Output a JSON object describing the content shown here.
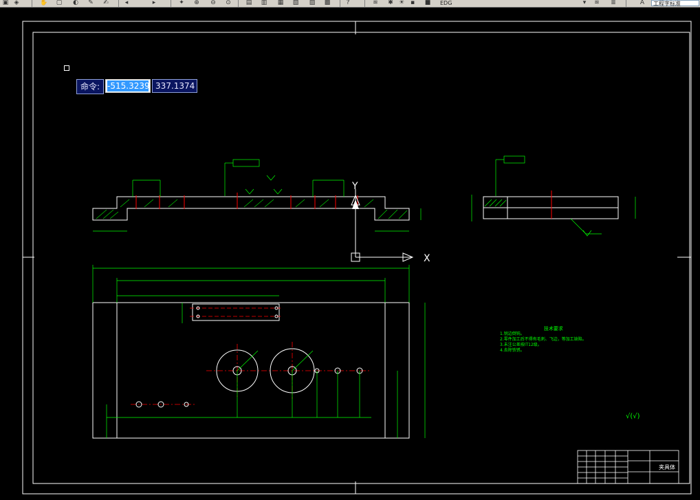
{
  "toolbar": {
    "layer_name": "EDG",
    "standard_combo": "工程字标准",
    "icons": [
      "open-icon",
      "save-icon",
      "undo-icon",
      "redo-icon",
      "pan-icon",
      "zoom-realtime-icon",
      "zoom-window-icon",
      "zoom-previous-icon",
      "properties-icon",
      "design-center-icon",
      "tool-palette-icon",
      "sheet-set-icon",
      "markup-icon",
      "quickcalc-icon",
      "help-icon",
      "layer-properties-icon",
      "layer-state-icon",
      "text-style-icon"
    ]
  },
  "command": {
    "label": "命令:",
    "x_value": "-515.3239",
    "y_value": "337.1374"
  },
  "ucs": {
    "x_label": "X",
    "y_label": "Y"
  },
  "technical_requirements": {
    "title": "技术要求",
    "items": [
      "1.锐边倒钝。",
      "2.零件加工后不得有毛刺、飞边，等加工缺陷。",
      "3.未注公差按IT12级。",
      "4.去除铁锈。"
    ]
  },
  "roughness_symbol": "√(√)",
  "title_block": {
    "part_name": "夹具体"
  },
  "colors": {
    "background": "#000000",
    "geometry": "#ffffff",
    "dimension": "#00ff00",
    "centerline": "#ff0000",
    "command_bg": "#0a1560",
    "selection": "#3399ff"
  }
}
